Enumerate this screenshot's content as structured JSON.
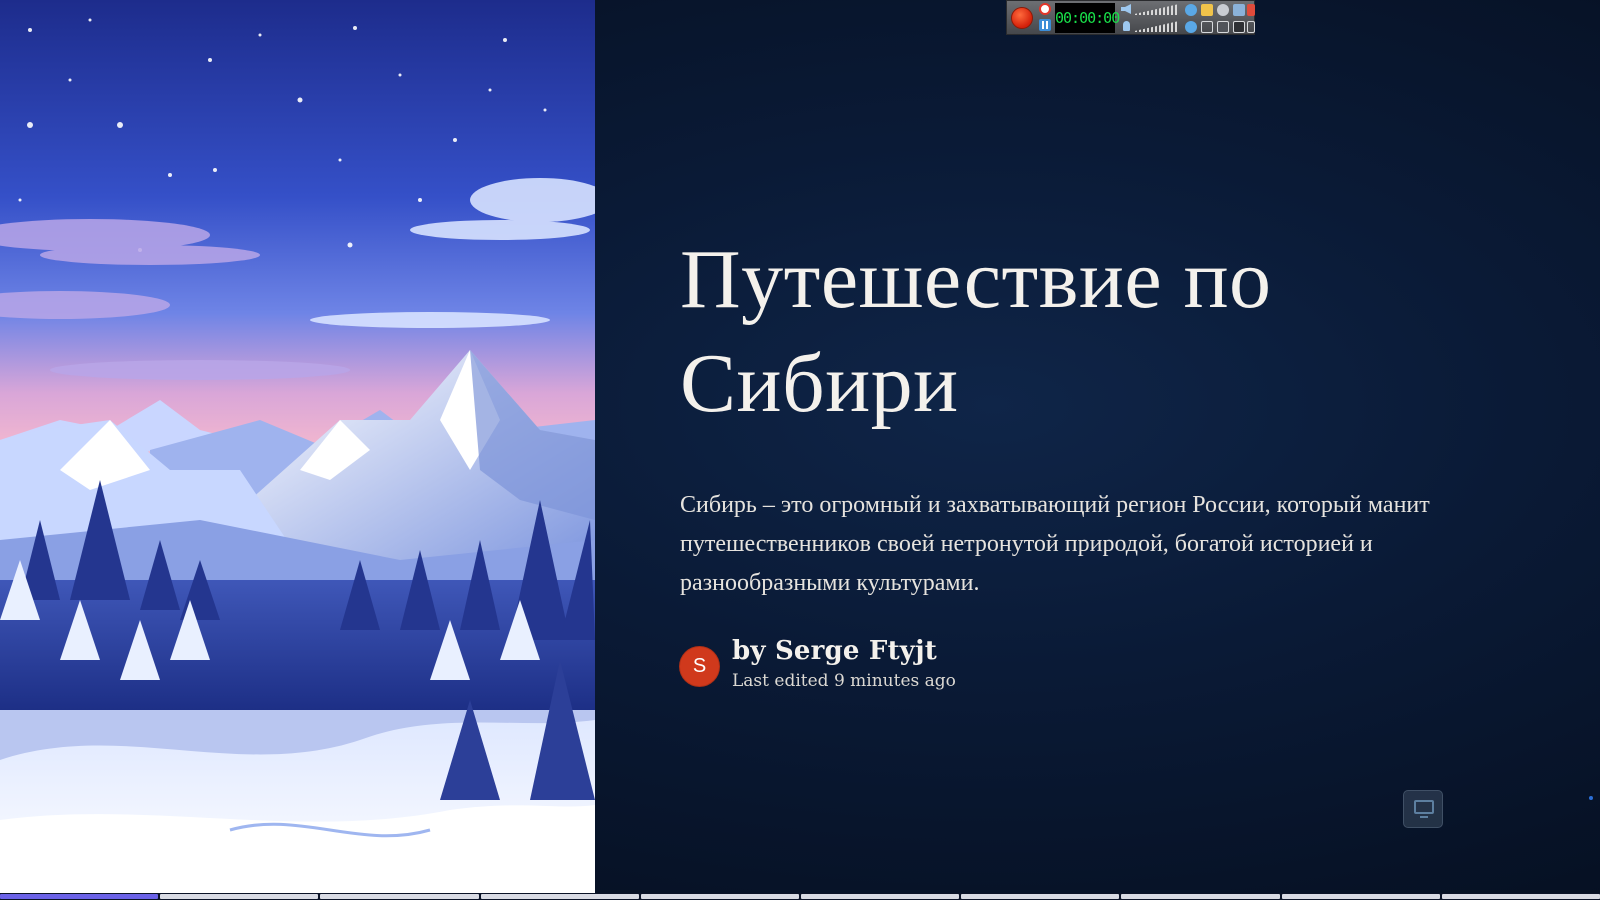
{
  "slide": {
    "title_line1": "Путешествие по",
    "title_line2": "Сибири",
    "subtitle": "Сибирь – это огромный и захватывающий регион России, который манит путешественников своей нетронутой природой, богатой историей и разнообразными культурами.",
    "author": {
      "initial": "S",
      "byline": "by Serge Ftyjt",
      "edited": "Last edited 9 minutes ago"
    }
  },
  "image": {
    "description": "Winter mountain landscape illustration with starry sky and snowy pine trees"
  },
  "recorder": {
    "time": "00:00:00"
  },
  "progress": {
    "total_slides": 10,
    "current_slide": 1
  },
  "colors": {
    "background": "#0a1a36",
    "avatar": "#d0391c",
    "progress_active": "#6b62e8",
    "progress_inactive": "#d9dbe4",
    "text": "#f4f1ec"
  },
  "icons": {
    "record": "record-icon",
    "alarm": "alarm-icon",
    "pause": "pause-icon",
    "volume": "volume-icon",
    "microphone": "microphone-icon",
    "corner": "monitor-icon"
  }
}
